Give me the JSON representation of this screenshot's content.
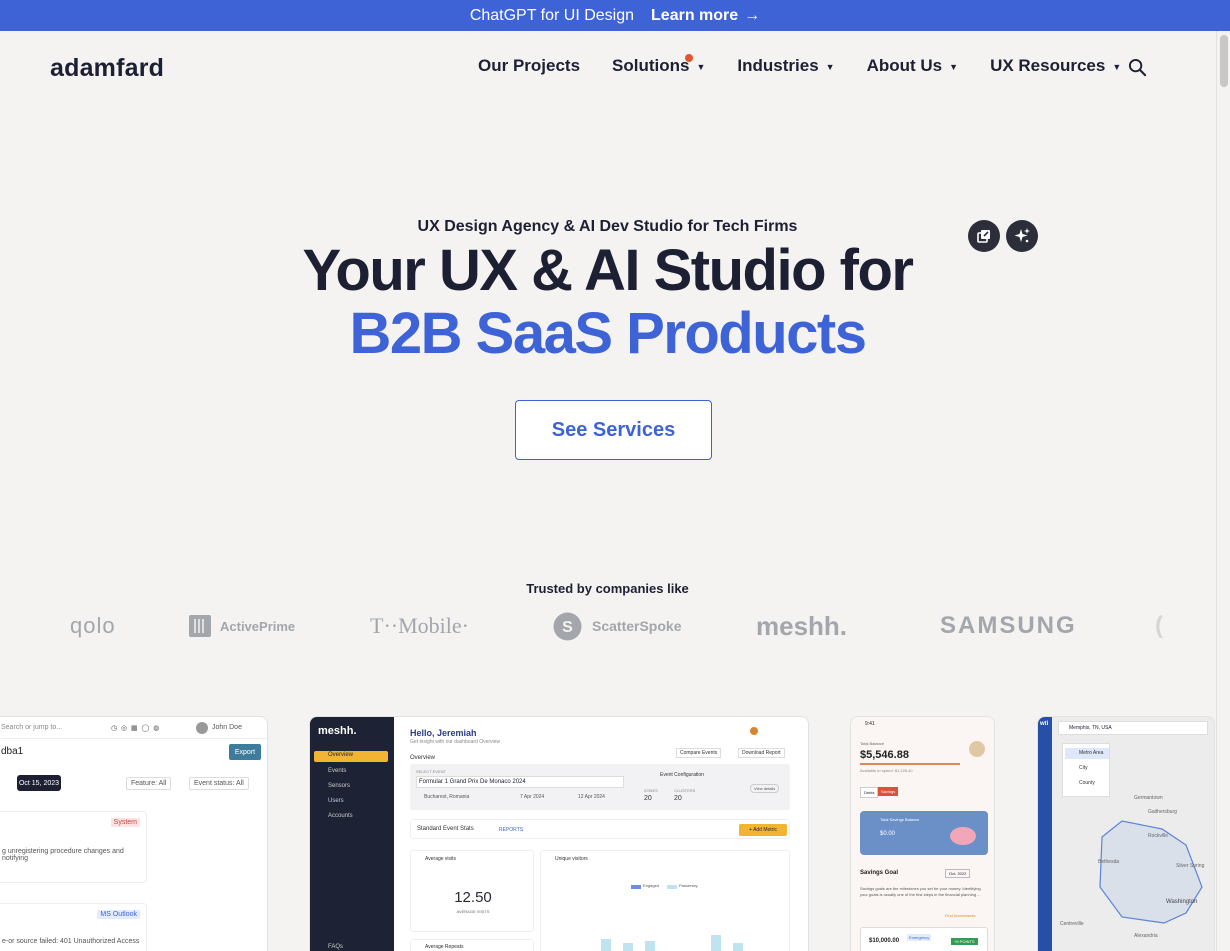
{
  "banner": {
    "text": "ChatGPT for UI Design",
    "link": "Learn more",
    "arrow": "→"
  },
  "header": {
    "logo": "adamfard",
    "nav": [
      {
        "label": "Our Projects",
        "caret": false
      },
      {
        "label": "Solutions",
        "caret": true,
        "dot": true
      },
      {
        "label": "Industries",
        "caret": true
      },
      {
        "label": "About Us",
        "caret": true
      },
      {
        "label": "UX Resources",
        "caret": true
      }
    ],
    "caret_glyph": "▼",
    "search_icon": "search-icon"
  },
  "hero": {
    "eyebrow": "UX Design Agency & AI Dev Studio for Tech Firms",
    "title_line1": "Your UX & AI Studio for",
    "title_line2": "B2B SaaS Products",
    "cta": "See Services",
    "floating_icons": [
      "external-window-icon",
      "sparkles-icon"
    ]
  },
  "trusted": {
    "label": "Trusted by companies like",
    "logos": [
      "qolo",
      "ActivePrime",
      "T··Mobile·",
      "ScatterSpoke",
      "meshh.",
      "SAMSUNG"
    ]
  },
  "showcase": {
    "shot1": {
      "search_placeholder": "Search or jump to...",
      "user": "John Doe",
      "title": "dba1",
      "export": "Export",
      "date": "Oct 15, 2023",
      "filter1": "Feature: All",
      "filter2": "Event status: All",
      "tag1": "System",
      "text1": "g unregistering procedure changes and notifying",
      "tag2": "MS Outlook",
      "text2": "e-or source failed: 401 Unauthorized Access"
    },
    "shot2": {
      "brand": "meshh.",
      "menu": [
        "Overview",
        "Events",
        "Sensors",
        "Users",
        "Accounts",
        "FAQs"
      ],
      "greeting": "Hello, Jeremiah",
      "sub": "Get insight with our dashboard Overview",
      "section": "Overview",
      "btn1": "Compare Events",
      "btn2": "Download Report",
      "select_label": "SELECT EVENT",
      "event": "Formular 1 Grand Prix De Monaco 2024",
      "location": "Bucharest, Romania",
      "date1": "7 Apr 2024",
      "date2": "12 Apr 2024",
      "config": "Event Configuration",
      "zones_label": "ZONES",
      "zones": "20",
      "clusters_label": "CLUSTERS",
      "clusters": "20",
      "view_details": "View details",
      "stats": "Standard Event Stats",
      "reports": "REPORTS",
      "add_metric": "+ Add Metric",
      "avg_visits": "Average visits",
      "avg_value": "12.50",
      "avg_caption": "AVERAGE VISITS",
      "unique": "Unique visitors",
      "avg_repeats": "Average Repeats",
      "legend1": "Engaged",
      "legend2": "Passersby"
    },
    "shot3": {
      "time": "9:41",
      "balance_label": "Total Balance",
      "balance": "$5,546.88",
      "avail": "Available to spend: $1,226.40",
      "tab1": "Debts",
      "tab2": "Savings",
      "card_label": "Total Savings Balance",
      "card_value": "$0.00",
      "goal": "Savings Goal",
      "goal_date": "Oct, 2022",
      "goal_text": "Savings goals are the milestones you set for your money. Identifying your goals is usually one of the first steps in the financial planning ...",
      "find": "Find Investments",
      "amount": "$10,000.00",
      "tag": "Emergency",
      "points": "+5 POINTS"
    },
    "shot4": {
      "logo": "wti",
      "search": "Memphis, TN, USA",
      "layers": [
        "Metro Area",
        "City",
        "County"
      ],
      "places": [
        "Germantown",
        "Gaithersburg",
        "Rockville",
        "Silver Spring",
        "Bethesda",
        "Washington",
        "Centreville",
        "Alexandria"
      ]
    }
  }
}
